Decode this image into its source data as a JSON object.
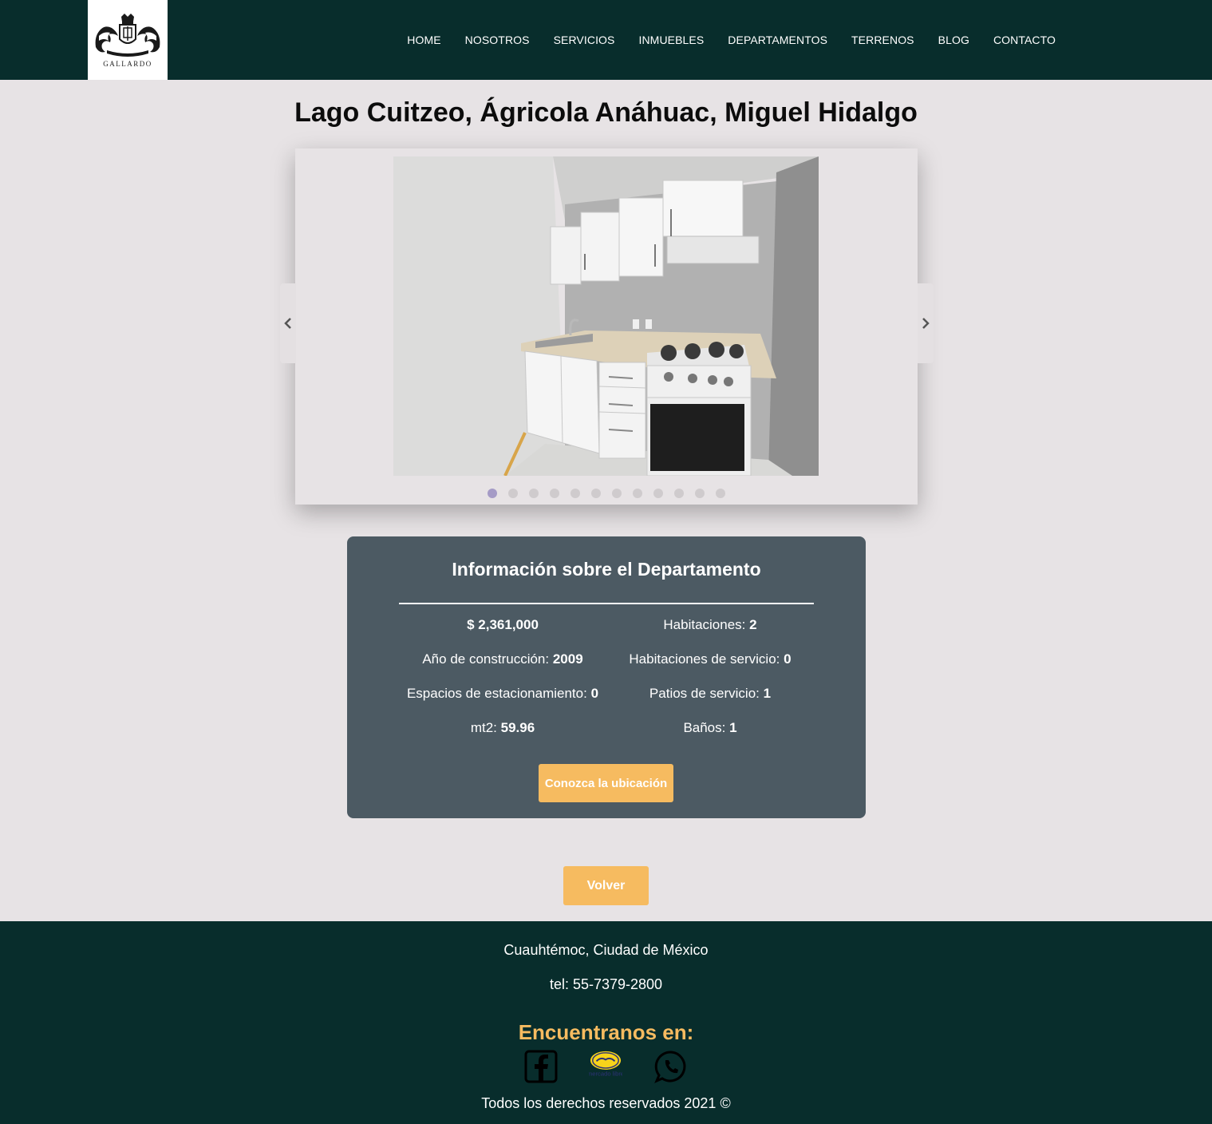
{
  "header": {
    "logo_text": "GALLARDO",
    "nav": [
      "HOME",
      "NOSOTROS",
      "SERVICIOS",
      "INMUEBLES",
      "DEPARTAMENTOS",
      "TERRENOS",
      "BLOG",
      "CONTACTO"
    ]
  },
  "property": {
    "title": "Lago Cuitzeo, Ágricola Anáhuac, Miguel Hidalgo"
  },
  "carousel": {
    "slide_count": 12,
    "active_index": 0,
    "prev_icon": "chevron-left-icon",
    "next_icon": "chevron-right-icon"
  },
  "info": {
    "title": "Información sobre el Departamento",
    "price": "$ 2,361,000",
    "rooms_label": "Habitaciones: ",
    "rooms_value": "2",
    "year_label": "Año de construcción: ",
    "year_value": "2009",
    "service_rooms_label": "Habitaciones de servicio: ",
    "service_rooms_value": "0",
    "parking_label": "Espacios de estacionamiento: ",
    "parking_value": "0",
    "service_patios_label": "Patios de servicio: ",
    "service_patios_value": "1",
    "area_label": "mt2: ",
    "area_value": "59.96",
    "bathrooms_label": "Baños: ",
    "bathrooms_value": "1",
    "location_button": "Conozca la ubicación"
  },
  "back_button": "Volver",
  "footer": {
    "location": "Cuauhtémoc, Ciudad de México",
    "phone": "tel: 55-7379-2800",
    "find_us": "Encuentranos en:",
    "mercadolibre_logo_text": "mercado libre",
    "copyright": "Todos los derechos reservados 2021 ©"
  },
  "colors": {
    "header_bg": "#082d2c",
    "page_bg": "#e7e3e5",
    "card_bg": "#4c5a63",
    "accent": "#f6bb60",
    "active_dot": "#a59bc6"
  }
}
